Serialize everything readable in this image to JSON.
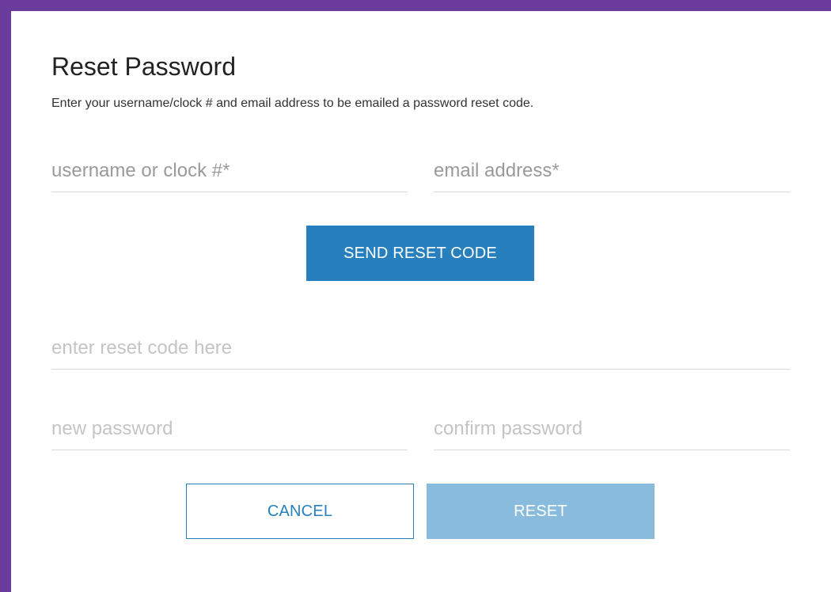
{
  "dialog": {
    "title": "Reset Password",
    "instructions": "Enter your username/clock # and email address to be emailed a password reset code."
  },
  "step1": {
    "username_placeholder": "username or clock #*",
    "email_placeholder": "email address*",
    "send_button_label": "SEND RESET CODE"
  },
  "step2": {
    "reset_code_placeholder": "enter reset code here",
    "new_password_placeholder": "new password",
    "confirm_password_placeholder": "confirm password"
  },
  "actions": {
    "cancel_label": "CANCEL",
    "reset_label": "RESET"
  },
  "colors": {
    "frame": "#6a3a9c",
    "primary": "#2780bd",
    "primary_disabled": "#89bcdc"
  }
}
